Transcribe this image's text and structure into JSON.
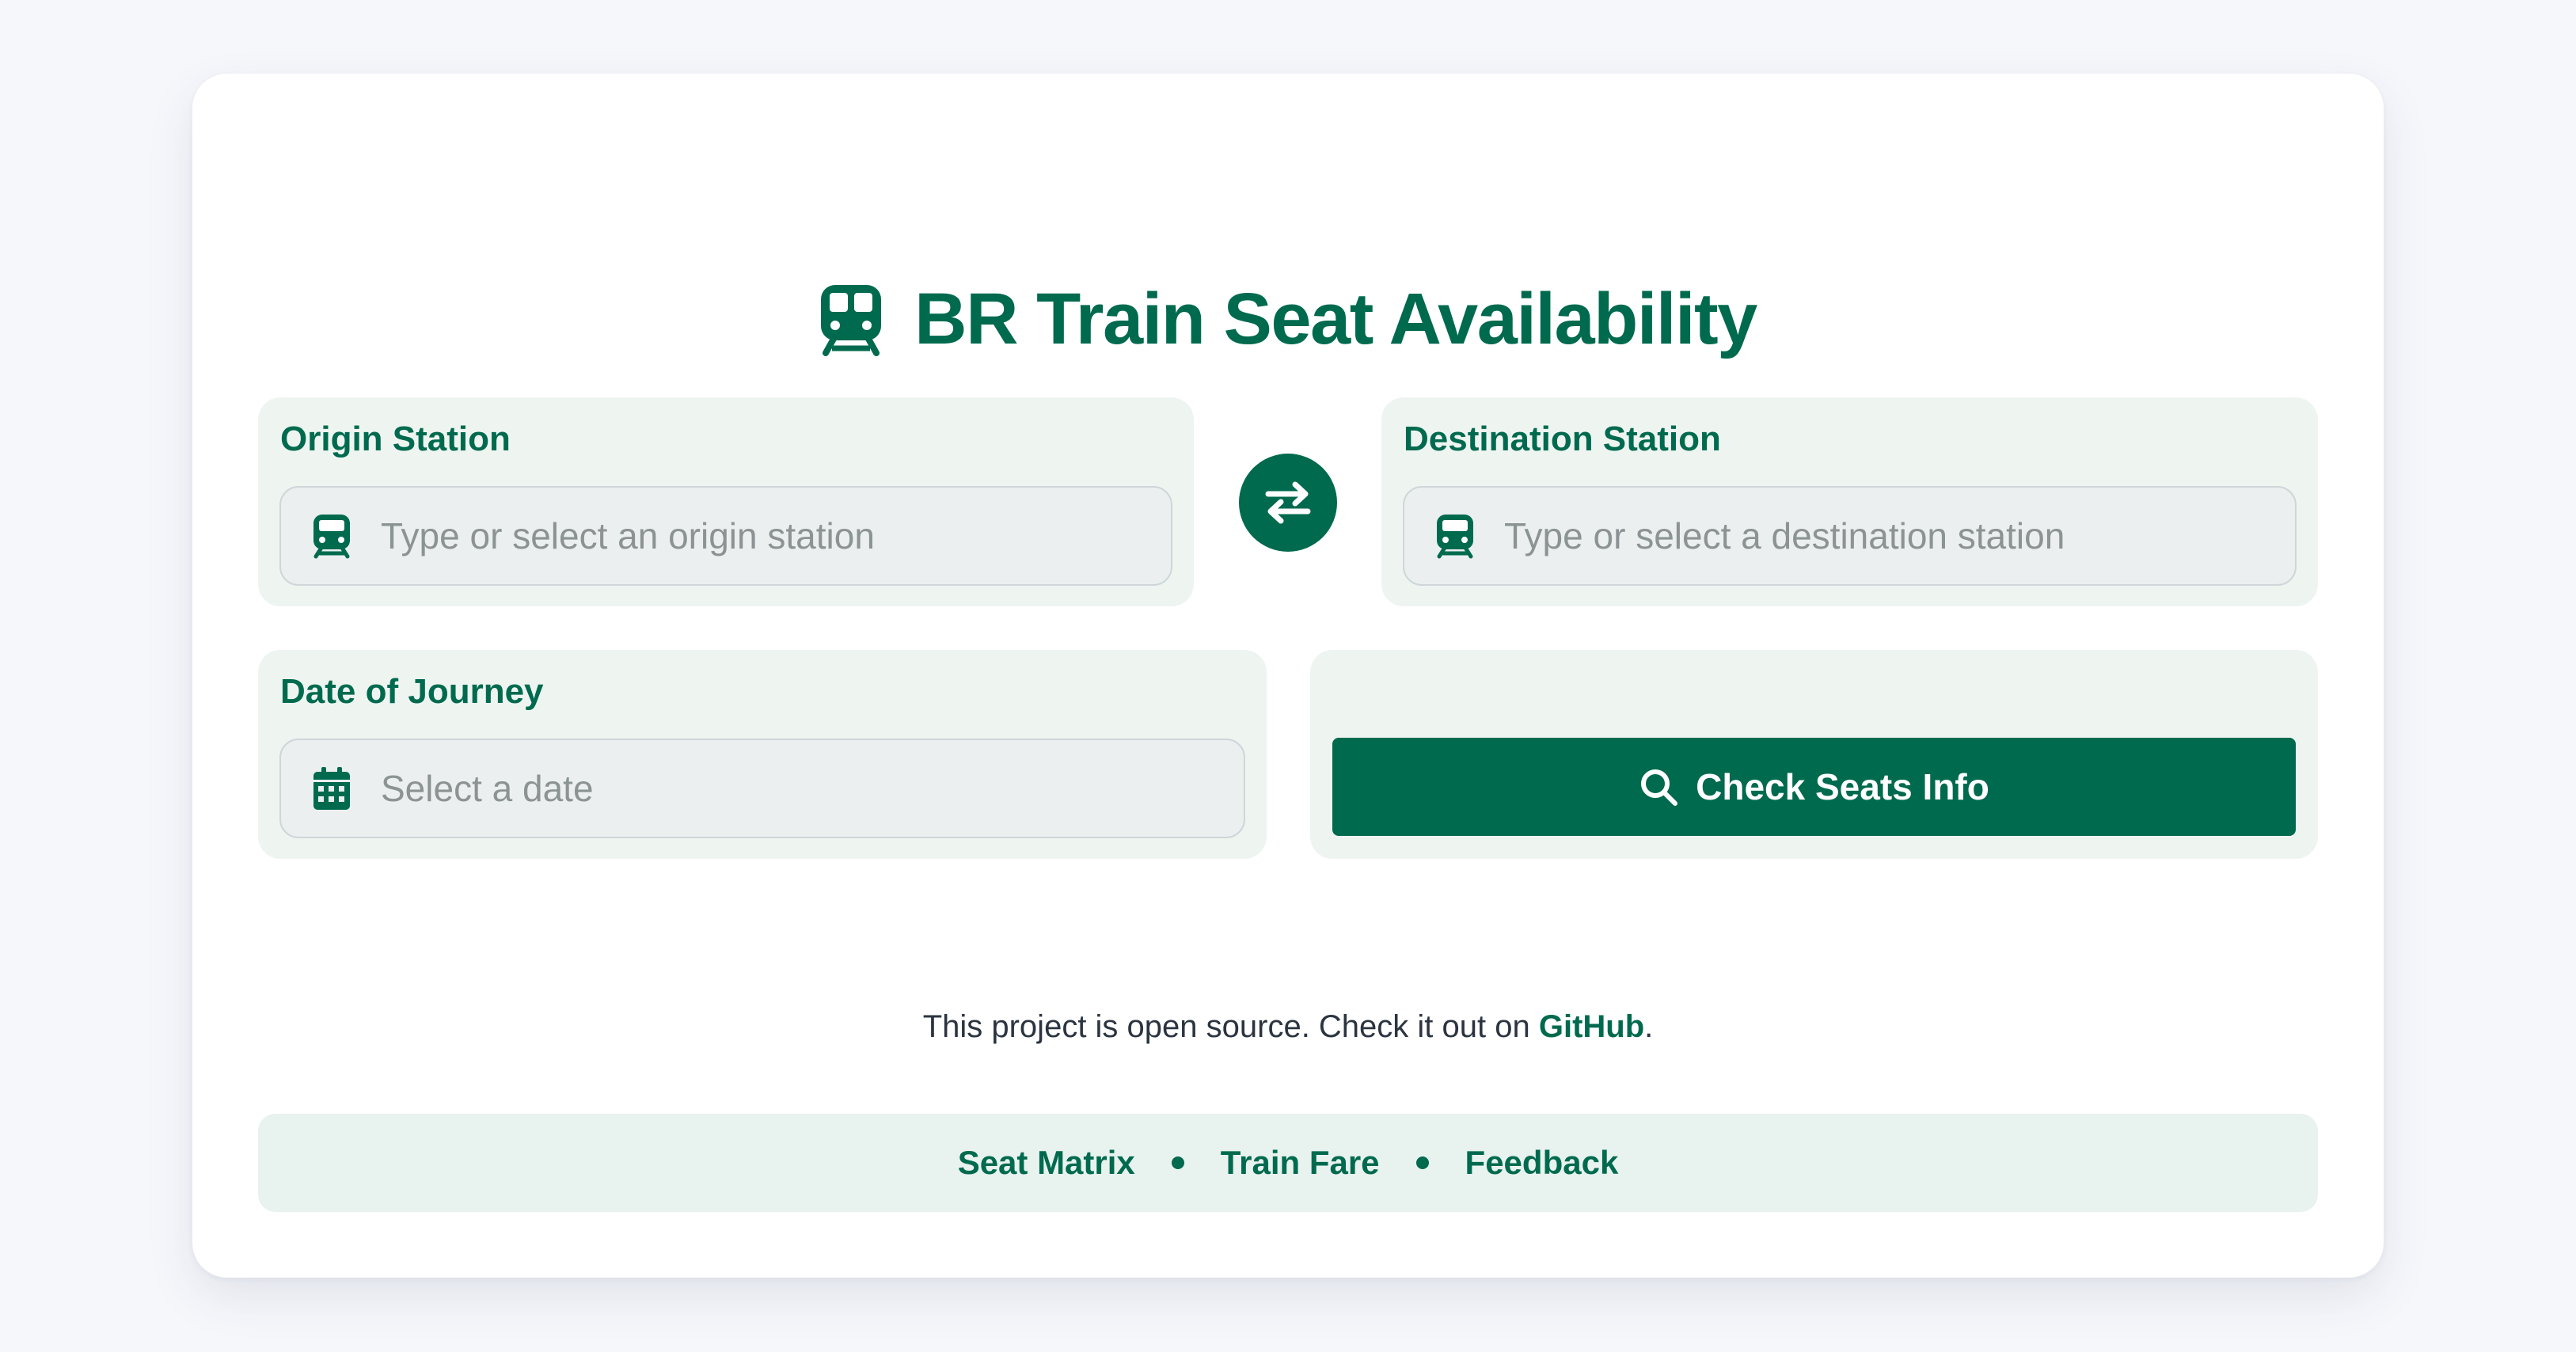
{
  "app": {
    "title": "BR Train Seat Availability",
    "title_icon": "train-icon",
    "accent_color": "#006a4e"
  },
  "form": {
    "origin": {
      "label": "Origin Station",
      "placeholder": "Type or select an origin station",
      "value": "",
      "icon": "train-icon"
    },
    "swap": {
      "icon": "swap-arrows-icon"
    },
    "destination": {
      "label": "Destination Station",
      "placeholder": "Type or select a destination station",
      "value": "",
      "icon": "train-icon"
    },
    "date": {
      "label": "Date of Journey",
      "placeholder": "Select a date",
      "value": "",
      "icon": "calendar-icon"
    },
    "submit": {
      "label": "Check Seats Info",
      "icon": "search-icon"
    }
  },
  "open_source": {
    "text_before": "This project is open source. Check it out on ",
    "link_label": "GitHub",
    "text_after": "."
  },
  "footer": {
    "links": [
      {
        "label": "Seat Matrix"
      },
      {
        "label": "Train Fare"
      },
      {
        "label": "Feedback"
      }
    ]
  }
}
